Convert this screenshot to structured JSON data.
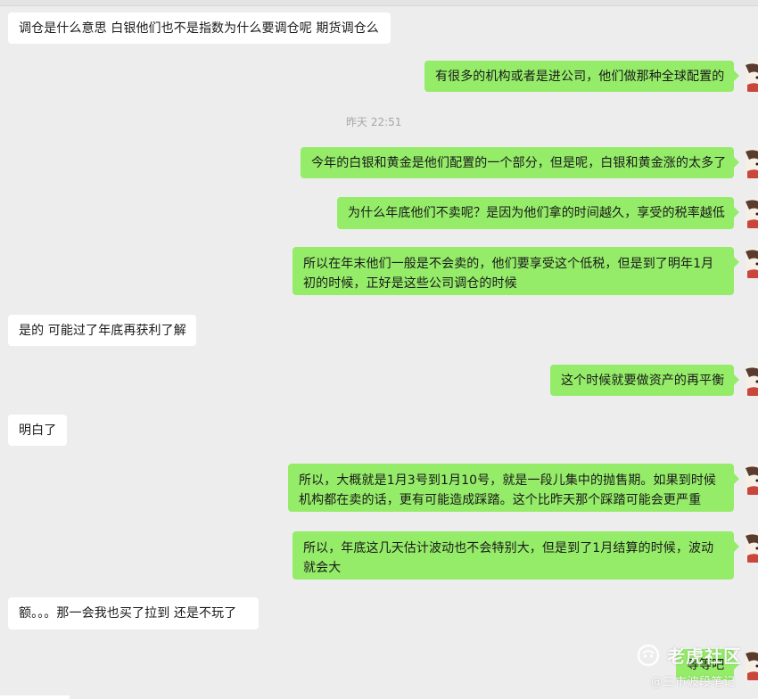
{
  "chat": {
    "timestamp": "昨天 22:51",
    "messages": [
      {
        "id": "m1",
        "side": "in",
        "text": "调仓是什么意思  白银他们也不是指数为什么要调仓呢 期货调仓么"
      },
      {
        "id": "m2",
        "side": "out",
        "text": "有很多的机构或者是进公司，他们做那种全球配置的"
      },
      {
        "id": "m3",
        "side": "out",
        "text": "今年的白银和黄金是他们配置的一个部分，但是呢，白银和黄金涨的太多了"
      },
      {
        "id": "m4",
        "side": "out",
        "text": "为什么年底他们不卖呢？是因为他们拿的时间越久，享受的税率越低"
      },
      {
        "id": "m5",
        "side": "out",
        "text": "所以在年末他们一般是不会卖的，他们要享受这个低税，但是到了明年1月初的时候，正好是这些公司调仓的时候"
      },
      {
        "id": "m6",
        "side": "in",
        "text": "是的 可能过了年底再获利了解"
      },
      {
        "id": "m7",
        "side": "out",
        "text": "这个时候就要做资产的再平衡"
      },
      {
        "id": "m8",
        "side": "in",
        "text": "明白了"
      },
      {
        "id": "m9",
        "side": "out",
        "text": "所以，大概就是1月3号到1月10号，就是一段儿集中的抛售期。如果到时候机构都在卖的话，更有可能造成踩踏。这个比昨天那个踩踏可能会更严重"
      },
      {
        "id": "m10",
        "side": "out",
        "text": "所以，年底这几天估计波动也不会特别大，但是到了1月结算的时候，波动就会大"
      },
      {
        "id": "m11",
        "side": "in",
        "text": "额。。。那一会我也买了拉到 还是不玩了"
      },
      {
        "id": "m12",
        "side": "out",
        "text": "等等吧"
      }
    ]
  },
  "watermark": {
    "brand": "老虎社区",
    "account": "@三市波段笔记",
    "logo_icon": "tiger-logo-icon"
  },
  "colors": {
    "background": "#ededed",
    "outgoing_bubble": "#95ec69",
    "incoming_bubble": "#ffffff",
    "timestamp_text": "#a6a6a6"
  }
}
